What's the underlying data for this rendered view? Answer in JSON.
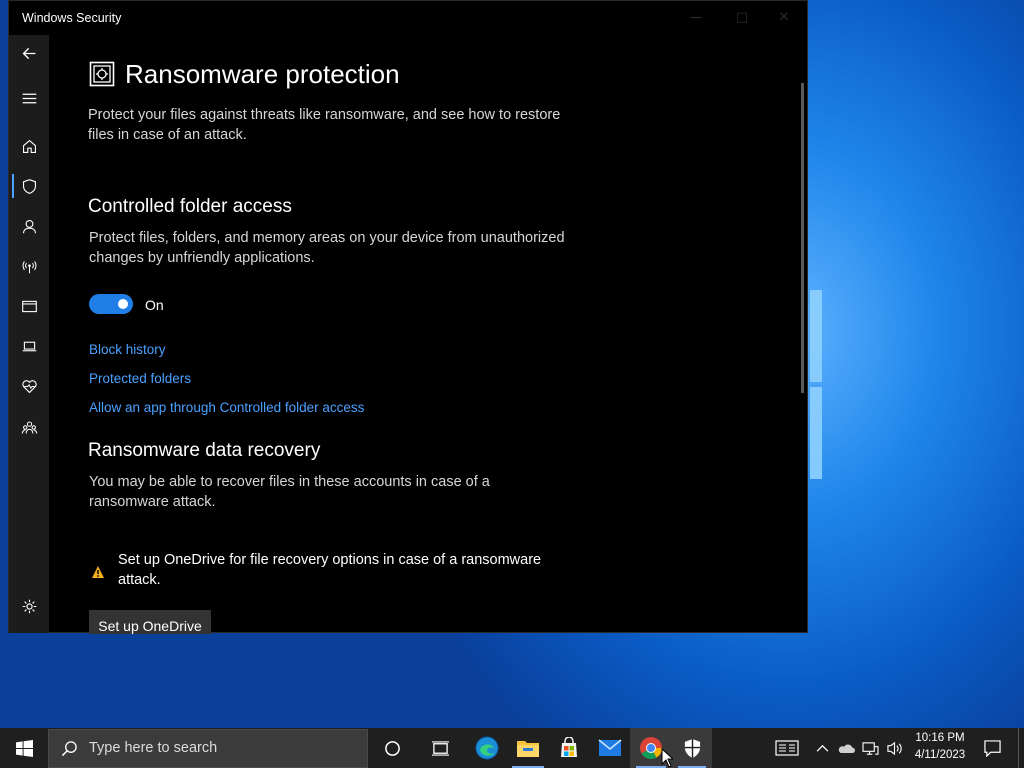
{
  "window": {
    "title": "Windows Security"
  },
  "sidebar": {
    "items": [
      {
        "icon": "back-arrow-icon"
      },
      {
        "icon": "hamburger-menu-icon"
      },
      {
        "icon": "home-icon"
      },
      {
        "icon": "shield-icon",
        "selected": true
      },
      {
        "icon": "account-icon"
      },
      {
        "icon": "wireless-network-icon"
      },
      {
        "icon": "browser-window-icon"
      },
      {
        "icon": "laptop-icon"
      },
      {
        "icon": "heart-health-icon"
      },
      {
        "icon": "family-icon"
      },
      {
        "icon": "settings-gear-icon"
      }
    ]
  },
  "page": {
    "title": "Ransomware protection",
    "description": "Protect your files against threats like ransomware, and see how to restore files in case of an attack.",
    "cfa": {
      "heading": "Controlled folder access",
      "description": "Protect files, folders, and memory areas on your device from unauthorized changes by unfriendly applications.",
      "toggle_label": "On",
      "toggle_on": true,
      "links": [
        "Block history",
        "Protected folders",
        "Allow an app through Controlled folder access"
      ]
    },
    "recovery": {
      "heading": "Ransomware data recovery",
      "description": "You may be able to recover files in these accounts in case of a ransomware attack.",
      "warning": "Set up OneDrive for file recovery options in case of a ransomware attack.",
      "button": "Set up OneDrive"
    }
  },
  "taskbar": {
    "search_placeholder": "Type here to search",
    "time": "10:16 PM",
    "date": "4/11/2023"
  },
  "colors": {
    "accent": "#1f7fe6",
    "link": "#4aa1ff",
    "warning": "#f2b01e"
  }
}
